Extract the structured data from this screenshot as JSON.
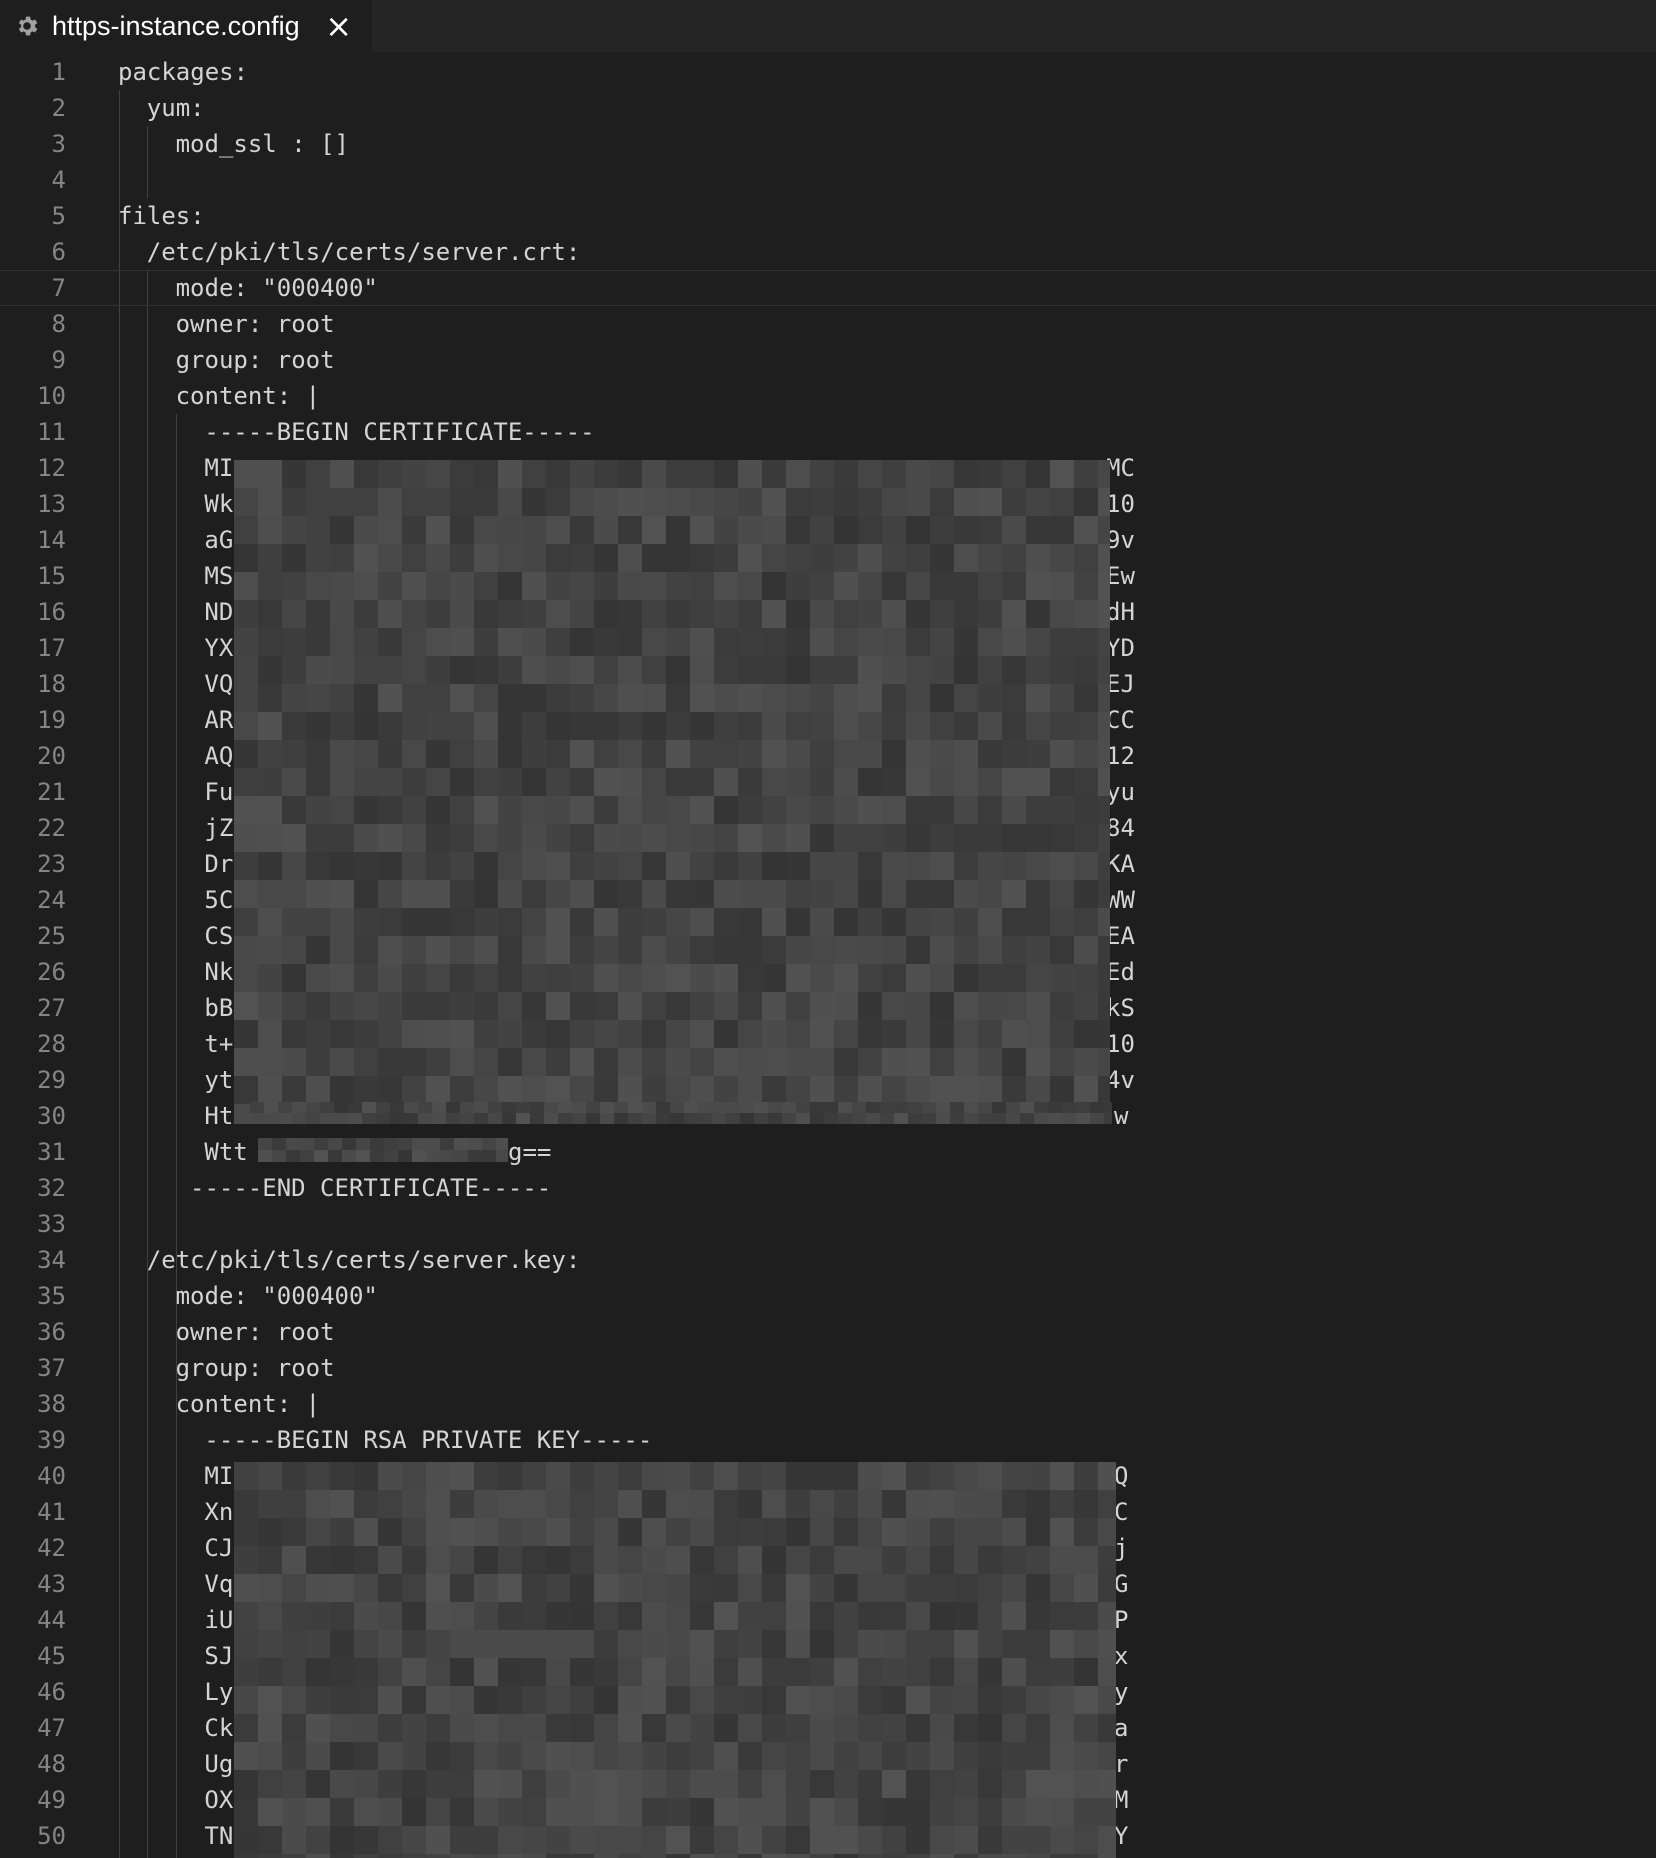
{
  "tab": {
    "title": "https-instance.config",
    "icon": "gear-icon",
    "close_glyph": "×"
  },
  "editor": {
    "current_line": 7,
    "lines": [
      {
        "n": "1",
        "indent": 0,
        "text": "packages:"
      },
      {
        "n": "2",
        "indent": 1,
        "text": "yum:"
      },
      {
        "n": "3",
        "indent": 2,
        "text": "mod_ssl : []"
      },
      {
        "n": "4",
        "indent": 0,
        "text": ""
      },
      {
        "n": "5",
        "indent": 0,
        "text": "files:"
      },
      {
        "n": "6",
        "indent": 1,
        "text": "/etc/pki/tls/certs/server.crt:"
      },
      {
        "n": "7",
        "indent": 2,
        "text": "mode: \"000400\""
      },
      {
        "n": "8",
        "indent": 2,
        "text": "owner: root"
      },
      {
        "n": "9",
        "indent": 2,
        "text": "group: root"
      },
      {
        "n": "10",
        "indent": 2,
        "text": "content: |"
      },
      {
        "n": "11",
        "indent": 3,
        "text": "-----BEGIN CERTIFICATE-----"
      },
      {
        "n": "12",
        "indent": 3,
        "text": "MI",
        "right": "MC"
      },
      {
        "n": "13",
        "indent": 3,
        "text": "Wk",
        "right": "10"
      },
      {
        "n": "14",
        "indent": 3,
        "text": "aG",
        "right": "9v"
      },
      {
        "n": "15",
        "indent": 3,
        "text": "MS",
        "right": "Ew"
      },
      {
        "n": "16",
        "indent": 3,
        "text": "ND",
        "right": "dH"
      },
      {
        "n": "17",
        "indent": 3,
        "text": "YX",
        "right": "YD"
      },
      {
        "n": "18",
        "indent": 3,
        "text": "VQ",
        "right": "EJ"
      },
      {
        "n": "19",
        "indent": 3,
        "text": "AR",
        "right": "CC"
      },
      {
        "n": "20",
        "indent": 3,
        "text": "AQ",
        "right": "12"
      },
      {
        "n": "21",
        "indent": 3,
        "text": "Fu",
        "right": "yu"
      },
      {
        "n": "22",
        "indent": 3,
        "text": "jZ",
        "right": "84"
      },
      {
        "n": "23",
        "indent": 3,
        "text": "Dr",
        "right": "KA"
      },
      {
        "n": "24",
        "indent": 3,
        "text": "5C",
        "right": "WW"
      },
      {
        "n": "25",
        "indent": 3,
        "text": "CS",
        "right": "EA"
      },
      {
        "n": "26",
        "indent": 3,
        "text": "Nk",
        "right": "Ed"
      },
      {
        "n": "27",
        "indent": 3,
        "text": "bB",
        "right": "kS"
      },
      {
        "n": "28",
        "indent": 3,
        "text": "t+",
        "right": "10"
      },
      {
        "n": "29",
        "indent": 3,
        "text": "yt",
        "right": "4v"
      },
      {
        "n": "30",
        "indent": 3,
        "text": "Ht",
        "right": "w"
      },
      {
        "n": "31",
        "indent": 3,
        "text": "Wtt",
        "right": "g=="
      },
      {
        "n": "32",
        "indent": 2.5,
        "text": "-----END CERTIFICATE-----"
      },
      {
        "n": "33",
        "indent": 0,
        "text": ""
      },
      {
        "n": "34",
        "indent": 1,
        "text": "/etc/pki/tls/certs/server.key:"
      },
      {
        "n": "35",
        "indent": 2,
        "text": "mode: \"000400\""
      },
      {
        "n": "36",
        "indent": 2,
        "text": "owner: root"
      },
      {
        "n": "37",
        "indent": 2,
        "text": "group: root"
      },
      {
        "n": "38",
        "indent": 2,
        "text": "content: |"
      },
      {
        "n": "39",
        "indent": 3,
        "text": "-----BEGIN RSA PRIVATE KEY-----"
      },
      {
        "n": "40",
        "indent": 3,
        "text": "MI",
        "right": "Q"
      },
      {
        "n": "41",
        "indent": 3,
        "text": "Xn",
        "right": "C"
      },
      {
        "n": "42",
        "indent": 3,
        "text": "CJ",
        "right": "j"
      },
      {
        "n": "43",
        "indent": 3,
        "text": "Vq",
        "right": "G"
      },
      {
        "n": "44",
        "indent": 3,
        "text": "iU",
        "right": "P"
      },
      {
        "n": "45",
        "indent": 3,
        "text": "SJ",
        "right": "x"
      },
      {
        "n": "46",
        "indent": 3,
        "text": "Ly",
        "right": "y"
      },
      {
        "n": "47",
        "indent": 3,
        "text": "Ck",
        "right": "a"
      },
      {
        "n": "48",
        "indent": 3,
        "text": "Ug",
        "right": "r"
      },
      {
        "n": "49",
        "indent": 3,
        "text": "OX",
        "right": "M"
      },
      {
        "n": "50",
        "indent": 3,
        "text": "TN",
        "right": "Y"
      }
    ]
  }
}
